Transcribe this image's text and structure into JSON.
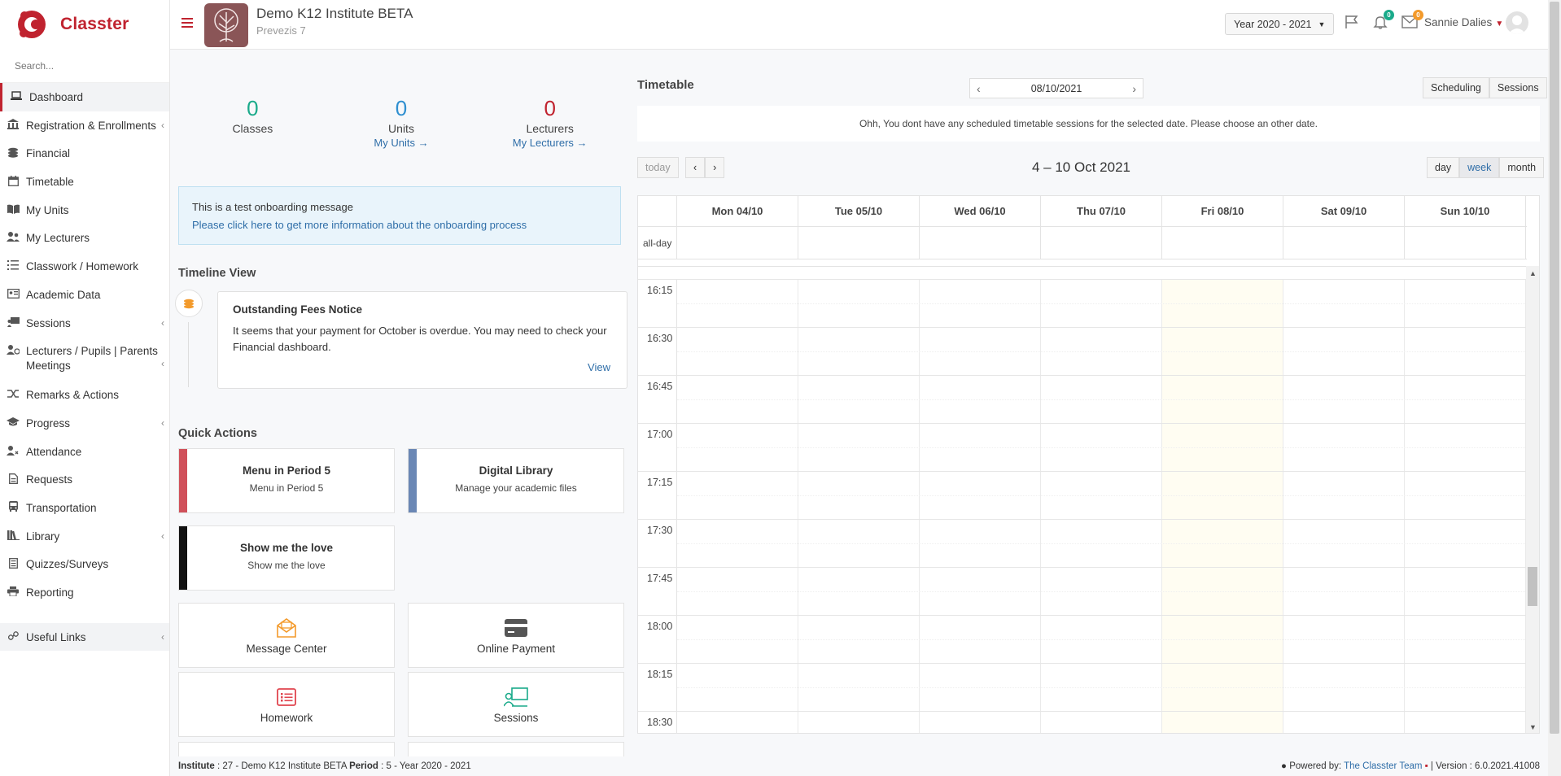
{
  "brand": {
    "name": "Classter"
  },
  "sidebar": {
    "search_placeholder": "Search...",
    "items": [
      {
        "label": "Dashboard",
        "icon": "laptop-icon"
      },
      {
        "label": "Registration & Enrollments",
        "icon": "institution-icon"
      },
      {
        "label": "Financial",
        "icon": "coins-icon"
      },
      {
        "label": "Timetable",
        "icon": "calendar-icon"
      },
      {
        "label": "My Units",
        "icon": "book-icon"
      },
      {
        "label": "My Lecturers",
        "icon": "users-icon"
      },
      {
        "label": "Classwork / Homework",
        "icon": "list-icon"
      },
      {
        "label": "Academic Data",
        "icon": "academic-icon"
      },
      {
        "label": "Sessions",
        "icon": "presentation-icon"
      },
      {
        "label": "Lecturers / Pupils | Parents Meetings",
        "icon": "meeting-icon"
      },
      {
        "label": "Remarks & Actions",
        "icon": "shuffle-icon"
      },
      {
        "label": "Progress",
        "icon": "graduation-cap-icon"
      },
      {
        "label": "Attendance",
        "icon": "user-check-icon"
      },
      {
        "label": "Requests",
        "icon": "document-icon"
      },
      {
        "label": "Transportation",
        "icon": "bus-icon"
      },
      {
        "label": "Library",
        "icon": "library-icon"
      },
      {
        "label": "Quizzes/Surveys",
        "icon": "quiz-icon"
      },
      {
        "label": "Reporting",
        "icon": "printer-icon"
      }
    ],
    "useful_links": "Useful Links"
  },
  "header": {
    "institute_name": "Demo K12 Institute BETA",
    "institute_sub": "Prevezis 7",
    "year": "Year 2020 - 2021",
    "notifications_count": "0",
    "messages_count": "0",
    "user_name": "Sannie Dalies"
  },
  "stats": {
    "classes": {
      "value": "0",
      "label": "Classes",
      "color": "#1aaa8a"
    },
    "units": {
      "value": "0",
      "label": "Units",
      "link": "My Units →",
      "color": "#2f8fd0"
    },
    "lecturers": {
      "value": "0",
      "label": "Lecturers",
      "link": "My Lecturers →",
      "color": "#c0232f"
    }
  },
  "onboarding": {
    "message": "This is a test onboarding message",
    "link": "Please click here to get more information about the onboarding process"
  },
  "timeline": {
    "title": "Timeline View",
    "card_title": "Outstanding Fees Notice",
    "card_text": "It seems that your payment for October is overdue. You may need to check your Financial dashboard.",
    "view": "View"
  },
  "quick_actions": {
    "title": "Quick Actions",
    "cards": [
      {
        "title": "Menu in Period 5",
        "sub": "Menu in Period 5",
        "color": "#d0505a"
      },
      {
        "title": "Digital Library",
        "sub": "Manage your academic files",
        "color": "#6a87b5"
      },
      {
        "title": "Show me the love",
        "sub": "Show me the love",
        "color": "#111111"
      }
    ],
    "tiles": [
      {
        "label": "Message Center",
        "icon": "envelope-icon",
        "color": "#f39a2b"
      },
      {
        "label": "Online Payment",
        "icon": "credit-card-icon",
        "color": "#555555"
      },
      {
        "label": "Homework",
        "icon": "list-icon",
        "color": "#e0454f"
      },
      {
        "label": "Sessions",
        "icon": "presentation-icon",
        "color": "#1aaa8a"
      }
    ]
  },
  "timetable": {
    "title": "Timetable",
    "date": "08/10/2021",
    "scheduling": "Scheduling",
    "sessions": "Sessions",
    "notice": "Ohh, You dont have any scheduled timetable sessions for the selected date. Please choose an other date.",
    "today": "today",
    "range": "4 – 10 Oct 2021",
    "view_day": "day",
    "view_week": "week",
    "view_month": "month",
    "allday": "all-day",
    "days": [
      "Mon 04/10",
      "Tue 05/10",
      "Wed 06/10",
      "Thu 07/10",
      "Fri 08/10",
      "Sat 09/10",
      "Sun 10/10"
    ],
    "times": [
      "16:15",
      "16:30",
      "16:45",
      "17:00",
      "17:15",
      "17:30",
      "17:45",
      "18:00",
      "18:15",
      "18:30"
    ]
  },
  "footer": {
    "institute_label": "Institute",
    "institute_value": ": 27 - Demo K12 Institute BETA",
    "period_label": "Period",
    "period_value": ": 5 - Year 2020 - 2021",
    "powered": "Powered by:",
    "team": "The Classter Team",
    "version": "| Version : 6.0.2021.41008"
  }
}
